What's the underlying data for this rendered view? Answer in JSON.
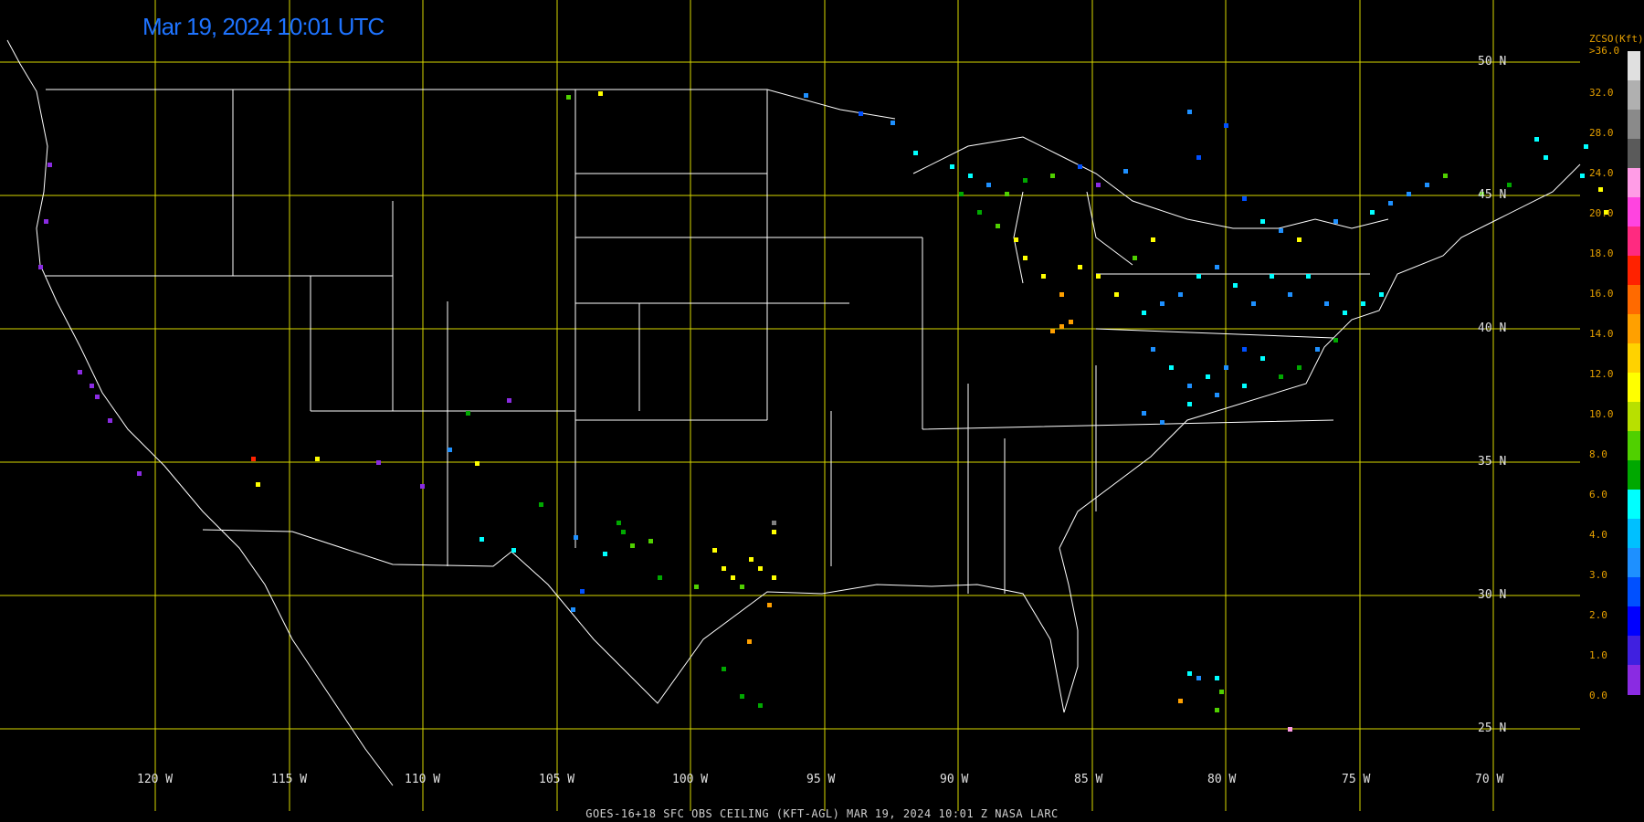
{
  "title": "Mar 19, 2024 10:01 UTC",
  "footer": "GOES-16+18  SFC OBS CEILING (KFT-AGL)   MAR 19, 2024 10:01 Z   NASA LARC",
  "lat_labels": [
    "50 N",
    "45 N",
    "40 N",
    "35 N",
    "30 N",
    "25 N"
  ],
  "lon_labels": [
    "120 W",
    "115 W",
    "110 W",
    "105 W",
    "100 W",
    "95 W",
    "90 W",
    "85 W",
    "80 W",
    "75 W",
    "70 W"
  ],
  "legend": {
    "title": "ZCSO(Kft)",
    "top_label": ">36.0",
    "values": [
      "32.0",
      "28.0",
      "24.0",
      "20.0",
      "18.0",
      "16.0",
      "14.0",
      "12.0",
      "10.0",
      "8.0",
      "6.0",
      "4.0",
      "3.0",
      "2.0",
      "1.0",
      "0.0"
    ],
    "colors": [
      "#e0e0e0",
      "#b0b0b0",
      "#8a8a8a",
      "#5a5a5a",
      "#ff9ce6",
      "#ff44e0",
      "#ff2a80",
      "#ff2200",
      "#ff6a00",
      "#ffa000",
      "#ffd200",
      "#ffff00",
      "#b8e000",
      "#50d000",
      "#00a800",
      "#00ffff",
      "#00c0ff",
      "#1e90ff",
      "#0050ff",
      "#0000ff",
      "#4020e0",
      "#8a2be2"
    ]
  },
  "colors": {
    "grid": "#d8d800",
    "borders": "#ffffff",
    "title": "#1e73ff",
    "labels": "#e6a000"
  }
}
